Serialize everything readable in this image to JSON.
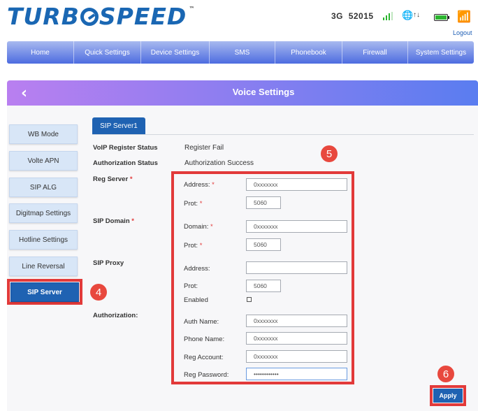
{
  "header": {
    "logo_part1": "TURB",
    "logo_part2": "SPEED",
    "logo_tm": "™",
    "network": "3G",
    "operator": "52015",
    "logout": "Logout",
    "status_icons": [
      "signal-bars-icon",
      "globe-icon",
      "data-arrows-icon",
      "battery-icon",
      "wifi-icon"
    ]
  },
  "nav": {
    "items": [
      "Home",
      "Quick Settings",
      "Device Settings",
      "SMS",
      "Phonebook",
      "Firewall",
      "System Settings"
    ]
  },
  "page": {
    "title": "Voice Settings",
    "back_icon": "‹"
  },
  "sidebar": {
    "items": [
      "WB Mode",
      "Volte APN",
      "SIP ALG",
      "Digitmap Settings",
      "Hotline Settings",
      "Line Reversal",
      "SIP Server"
    ],
    "active": "SIP Server"
  },
  "tab": {
    "label": "SIP Server1"
  },
  "form": {
    "voip_status_label": "VoIP Register Status",
    "voip_status_value": "Register Fail",
    "auth_status_label": "Authorization Status",
    "auth_status_value": "Authorization Success",
    "reg_server_label": "Reg Server",
    "sip_domain_label": "SIP Domain",
    "sip_proxy_label": "SIP Proxy",
    "authorization_label": "Authorization:",
    "required_mark": "*",
    "reg_address_label": "Address:",
    "reg_address_value": "0xxxxxxx",
    "reg_prot_label": "Prot:",
    "reg_prot_value": "5060",
    "domain_label": "Domain:",
    "domain_value": "0xxxxxxx",
    "domain_prot_label": "Prot:",
    "domain_prot_value": "5060",
    "proxy_address_label": "Address:",
    "proxy_address_value": "",
    "proxy_prot_label": "Prot:",
    "proxy_prot_value": "5060",
    "enabled_label": "Enabled",
    "auth_name_label": "Auth Name:",
    "auth_name_value": "0xxxxxxx",
    "phone_name_label": "Phone Name:",
    "phone_name_value": "0xxxxxxx",
    "reg_account_label": "Reg Account:",
    "reg_account_value": "0xxxxxxx",
    "reg_password_label": "Reg Password:",
    "reg_password_value": "••••••••••••"
  },
  "annotations": {
    "step4": "4",
    "step5": "5",
    "step6": "6"
  },
  "apply_label": "Apply",
  "colors": {
    "brand": "#1a67b3",
    "nav_gradient": [
      "#a8b9ef",
      "#4d6ce0"
    ],
    "title_gradient": [
      "#b97ff0",
      "#5a7df0"
    ],
    "active": "#1f62b2",
    "highlight": "#e23a3a"
  }
}
